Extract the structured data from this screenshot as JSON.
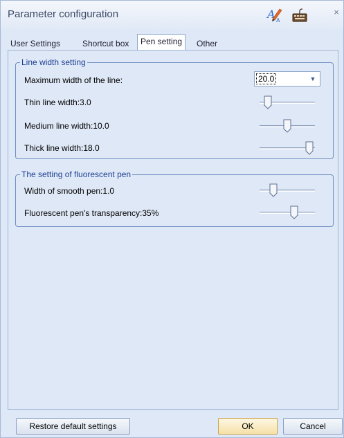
{
  "window": {
    "title": "Parameter configuration",
    "icons": [
      "pen-settings-icon",
      "keyboard-icon",
      "close-icon"
    ],
    "close_glyph": "×"
  },
  "tabs": [
    {
      "label": "User Settings",
      "active": false
    },
    {
      "label": "Shortcut box",
      "active": false
    },
    {
      "label": "Pen setting",
      "active": true
    },
    {
      "label": "Other",
      "active": false
    }
  ],
  "line_width_group": {
    "title": "Line width setting",
    "max_width": {
      "label": "Maximum width of the line:",
      "value": "20.0"
    },
    "thin": {
      "label": "Thin line width:3.0",
      "level": 0.15
    },
    "medium": {
      "label": "Medium line width:10.0",
      "level": 0.5
    },
    "thick": {
      "label": "Thick line width:18.0",
      "level": 0.9
    }
  },
  "fluorescent_group": {
    "title": "The setting of fluorescent pen",
    "smooth": {
      "label": "Width of smooth pen:1.0",
      "level": 0.25
    },
    "transparency": {
      "label": "Fluorescent pen's transparency:35%",
      "level": 0.62
    }
  },
  "buttons": {
    "restore": "Restore default settings",
    "ok": "OK",
    "cancel": "Cancel"
  },
  "colors": {
    "window_bg": "#dfe8f6",
    "group_title": "#1c3f94",
    "group_border": "#6f8fc2"
  }
}
